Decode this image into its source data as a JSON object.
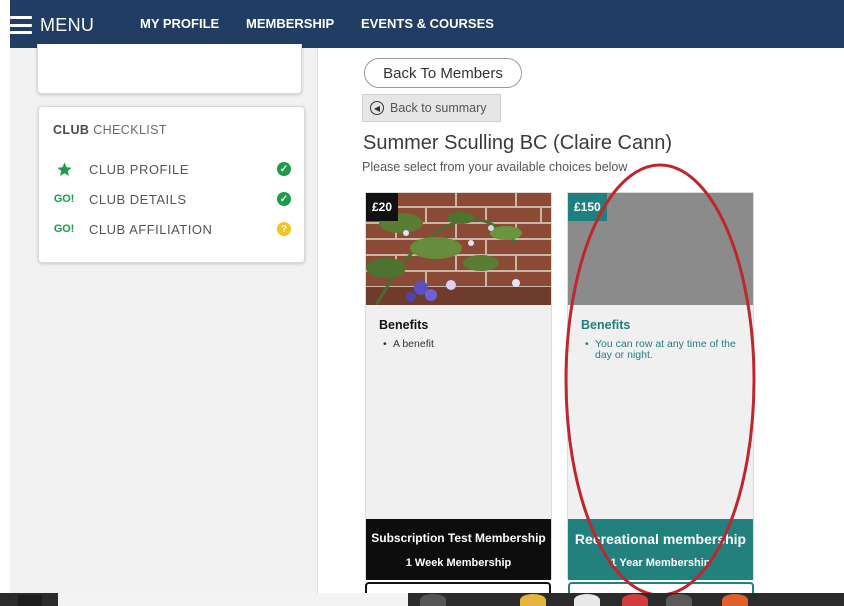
{
  "nav": {
    "menu_label": "MENU",
    "links": [
      "MY PROFILE",
      "MEMBERSHIP",
      "EVENTS & COURSES"
    ]
  },
  "checklist": {
    "title_bold": "CLUB",
    "title_rest": " CHECKLIST",
    "items": [
      {
        "badge": "star-icon",
        "label": "CLUB PROFILE",
        "status": "complete"
      },
      {
        "badge": "GO!",
        "label": "CLUB DETAILS",
        "status": "complete"
      },
      {
        "badge": "GO!",
        "label": "CLUB AFFILIATION",
        "status": "pending"
      }
    ]
  },
  "main": {
    "back_to_members": "Back To Members",
    "back_to_summary": "Back to summary",
    "club_title": "Summer Sculling BC (Claire Cann)",
    "subtitle": "Please select from your available choices below"
  },
  "cards": [
    {
      "price": "£20",
      "image": "flower-photo",
      "benefits_title": "Benefits",
      "benefits": [
        "A benefit"
      ],
      "name": "Subscription Test Membership",
      "duration": "1 Week Membership",
      "color": "#0d0d0d"
    },
    {
      "price": "£150",
      "image": "placeholder",
      "benefits_title": "Benefits",
      "benefits": [
        "You can row at any time of the day or night."
      ],
      "name": "Recreational membership",
      "duration": "1 Year Membership",
      "color": "#22807d"
    }
  ],
  "colors": {
    "nav_bg": "#213d63",
    "teal": "#22807d",
    "annotation": "#c0262d"
  }
}
